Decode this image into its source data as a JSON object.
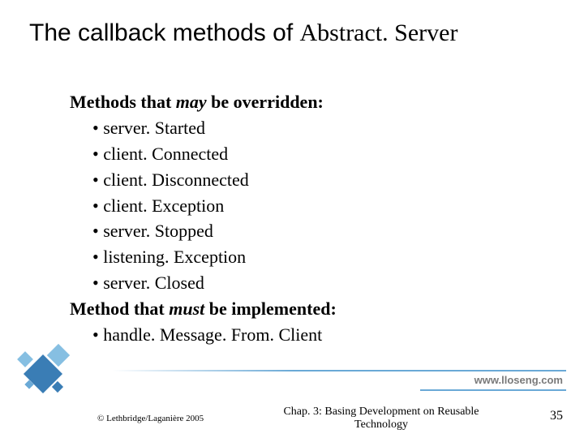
{
  "title": {
    "prefix": "The callback methods of ",
    "classname": "Abstract. Server"
  },
  "section1": {
    "lead": "Methods that ",
    "emph": "may",
    "tail": " be overridden:"
  },
  "bullets1": [
    "server. Started",
    "client. Connected",
    "client. Disconnected",
    "client. Exception",
    "server. Stopped",
    "listening. Exception",
    "server. Closed"
  ],
  "section2": {
    "lead": "Method that ",
    "emph": "must",
    "tail": " be implemented:"
  },
  "bullets2": [
    "handle. Message. From. Client"
  ],
  "url": "www.lloseng.com",
  "copyright": "© Lethbridge/Laganière 2005",
  "chapter": "Chap. 3: Basing Development on Reusable Technology",
  "page": "35"
}
